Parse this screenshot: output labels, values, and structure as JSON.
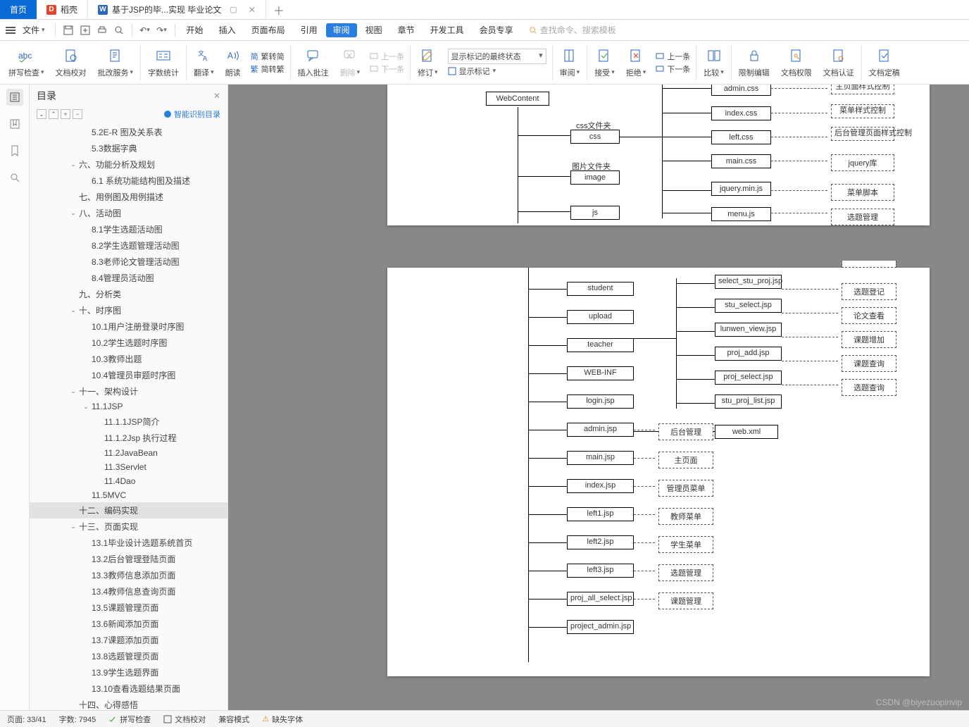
{
  "titlebar": {
    "home": "首页",
    "doke": "稻壳",
    "doc": "基于JSP的毕...实现 毕业论文"
  },
  "menubar": {
    "file": "文件",
    "tabs": [
      "开始",
      "插入",
      "页面布局",
      "引用",
      "审阅",
      "视图",
      "章节",
      "开发工具",
      "会员专享"
    ],
    "active": "审阅",
    "search_placeholder": "查找命令、搜索模板"
  },
  "ribbon": {
    "spellcheck": "拼写检查",
    "docproof": "文档校对",
    "approval": "批改服务",
    "wordcount": "字数统计",
    "translate": "翻译",
    "readaloud": "朗读",
    "fan_to_jian": "繁转简",
    "jian_to_fan": "简转繁",
    "insert_comment": "插入批注",
    "delete": "删除",
    "prev_comment": "上一条",
    "next_comment": "下一条",
    "track": "修订",
    "track_select": "显示标记的最终状态",
    "show_marks": "显示标记",
    "review": "审阅",
    "accept": "接受",
    "reject": "拒绝",
    "prev_change": "上一条",
    "next_change": "下一条",
    "compare": "比较",
    "restrict": "限制编辑",
    "permissions": "文档权限",
    "certify": "文档认证",
    "finalize": "文档定稿"
  },
  "toc": {
    "title": "目录",
    "smart": "智能识别目录",
    "items": [
      {
        "t": "5.2E-R 图及关系表",
        "d": 3
      },
      {
        "t": "5.3数据字典",
        "d": 3
      },
      {
        "t": "六、功能分析及规划",
        "d": 2,
        "exp": true
      },
      {
        "t": "6.1 系统功能结构图及描述",
        "d": 3
      },
      {
        "t": "七、用例图及用例描述",
        "d": 2
      },
      {
        "t": "八、活动图",
        "d": 2,
        "exp": true
      },
      {
        "t": "8.1学生选题活动图",
        "d": 3
      },
      {
        "t": "8.2学生选题管理活动图",
        "d": 3
      },
      {
        "t": "8.3老师论文管理活动图",
        "d": 3
      },
      {
        "t": "8.4管理员活动图",
        "d": 3
      },
      {
        "t": "九、分析类",
        "d": 2
      },
      {
        "t": "十、时序图",
        "d": 2,
        "exp": true
      },
      {
        "t": "10.1用户注册登录时序图",
        "d": 3
      },
      {
        "t": "10.2学生选题时序图",
        "d": 3
      },
      {
        "t": "10.3教师出题",
        "d": 3
      },
      {
        "t": "10.4管理员审题时序图",
        "d": 3
      },
      {
        "t": "十一、架构设计",
        "d": 2,
        "exp": true
      },
      {
        "t": "11.1JSP",
        "d": 3,
        "exp": true
      },
      {
        "t": "11.1.1JSP简介",
        "d": 4
      },
      {
        "t": "11.1.2Jsp 执行过程",
        "d": 4
      },
      {
        "t": "11.2JavaBean",
        "d": 4
      },
      {
        "t": "11.3Servlet",
        "d": 4
      },
      {
        "t": "11.4Dao",
        "d": 4
      },
      {
        "t": "11.5MVC",
        "d": 3
      },
      {
        "t": "十二、编码实现",
        "d": 2,
        "sel": true
      },
      {
        "t": "十三、页面实现",
        "d": 2,
        "exp": true
      },
      {
        "t": "13.1毕业设计选题系统首页",
        "d": 3
      },
      {
        "t": "13.2后台管理登陆页面",
        "d": 3
      },
      {
        "t": "13.3教师信息添加页面",
        "d": 3
      },
      {
        "t": "13.4教师信息查询页面",
        "d": 3
      },
      {
        "t": "13.5课题管理页面",
        "d": 3
      },
      {
        "t": "13.6新闻添加页面",
        "d": 3
      },
      {
        "t": "13.7课题添加页面",
        "d": 3
      },
      {
        "t": "13.8选题管理页面",
        "d": 3
      },
      {
        "t": "13.9学生选题界面",
        "d": 3
      },
      {
        "t": "13.10查看选题结果页面",
        "d": 3
      },
      {
        "t": "十四、心得感悟",
        "d": 2
      }
    ]
  },
  "diagram1": {
    "webcontent": "WebContent",
    "css_folder": "css文件夹",
    "css": "css",
    "img_folder": "图片文件夹",
    "image": "image",
    "js": "js",
    "files": [
      "admin.css",
      "index.css",
      "left.css",
      "main.css",
      "jquery.min.js",
      "menu.js"
    ],
    "right": [
      "菜单样式控制",
      "后台管理页面样式控制",
      "jquery库",
      "菜单脚本",
      "选题管理"
    ],
    "right_cut": "主页面样式控制"
  },
  "diagram2": {
    "left": [
      "student",
      "upload",
      "teacher",
      "WEB-INF",
      "login.jsp",
      "admin.jsp",
      "main.jsp",
      "index.jsp",
      "left1.jsp",
      "left2.jsp",
      "left3.jsp",
      "proj_all_select.jsp",
      "project_admin.jsp"
    ],
    "mid": [
      "select_stu_proj.jsp",
      "stu_select.jsp",
      "lunwen_view.jsp",
      "proj_add.jsp",
      "proj_select.jsp",
      "stu_proj_list.jsp",
      "web.xml"
    ],
    "right_top": [
      "选题登记",
      "论文查看",
      "课题增加",
      "课题查询",
      "选题查询"
    ],
    "right_bot": [
      "后台管理",
      "主页面",
      "管理员菜单",
      "教师菜单",
      "学生菜单",
      "选题管理",
      "课题管理"
    ]
  },
  "status": {
    "page": "页面: 33/41",
    "words": "字数: 7945",
    "spell": "拼写检查",
    "proof": "文档校对",
    "compat": "兼容模式",
    "missing": "缺失字体"
  },
  "watermark": "CSDN @biyezuopinvip"
}
